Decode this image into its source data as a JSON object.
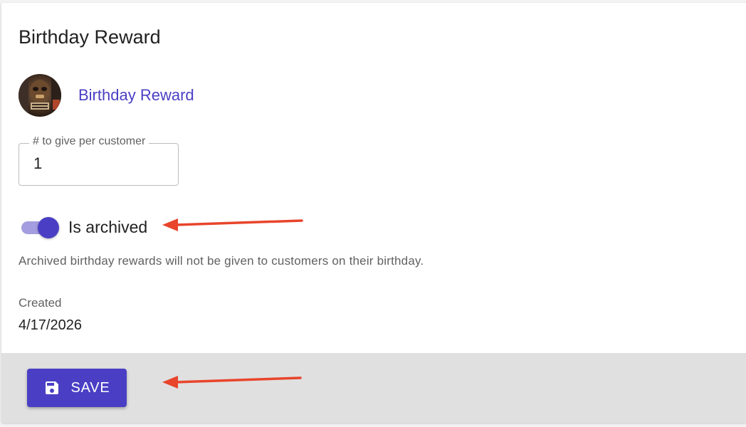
{
  "card": {
    "title": "Birthday Reward"
  },
  "reward": {
    "name": "Birthday Reward",
    "avatar_icon": "reward-image"
  },
  "quantity_field": {
    "label": "# to give per customer",
    "value": "1"
  },
  "archive_switch": {
    "label": "Is archived",
    "checked": true,
    "helper_text": "Archived birthday rewards will not be given to customers on their birthday."
  },
  "created": {
    "label": "Created",
    "value": "4/17/2026"
  },
  "footer": {
    "save_label": "SAVE",
    "save_icon": "floppy-disk-icon"
  },
  "colors": {
    "accent": "#4a3fc4",
    "track": "#a49ddf",
    "annotation_arrow": "#e8452c",
    "footer_bg": "#e0e0e0"
  }
}
